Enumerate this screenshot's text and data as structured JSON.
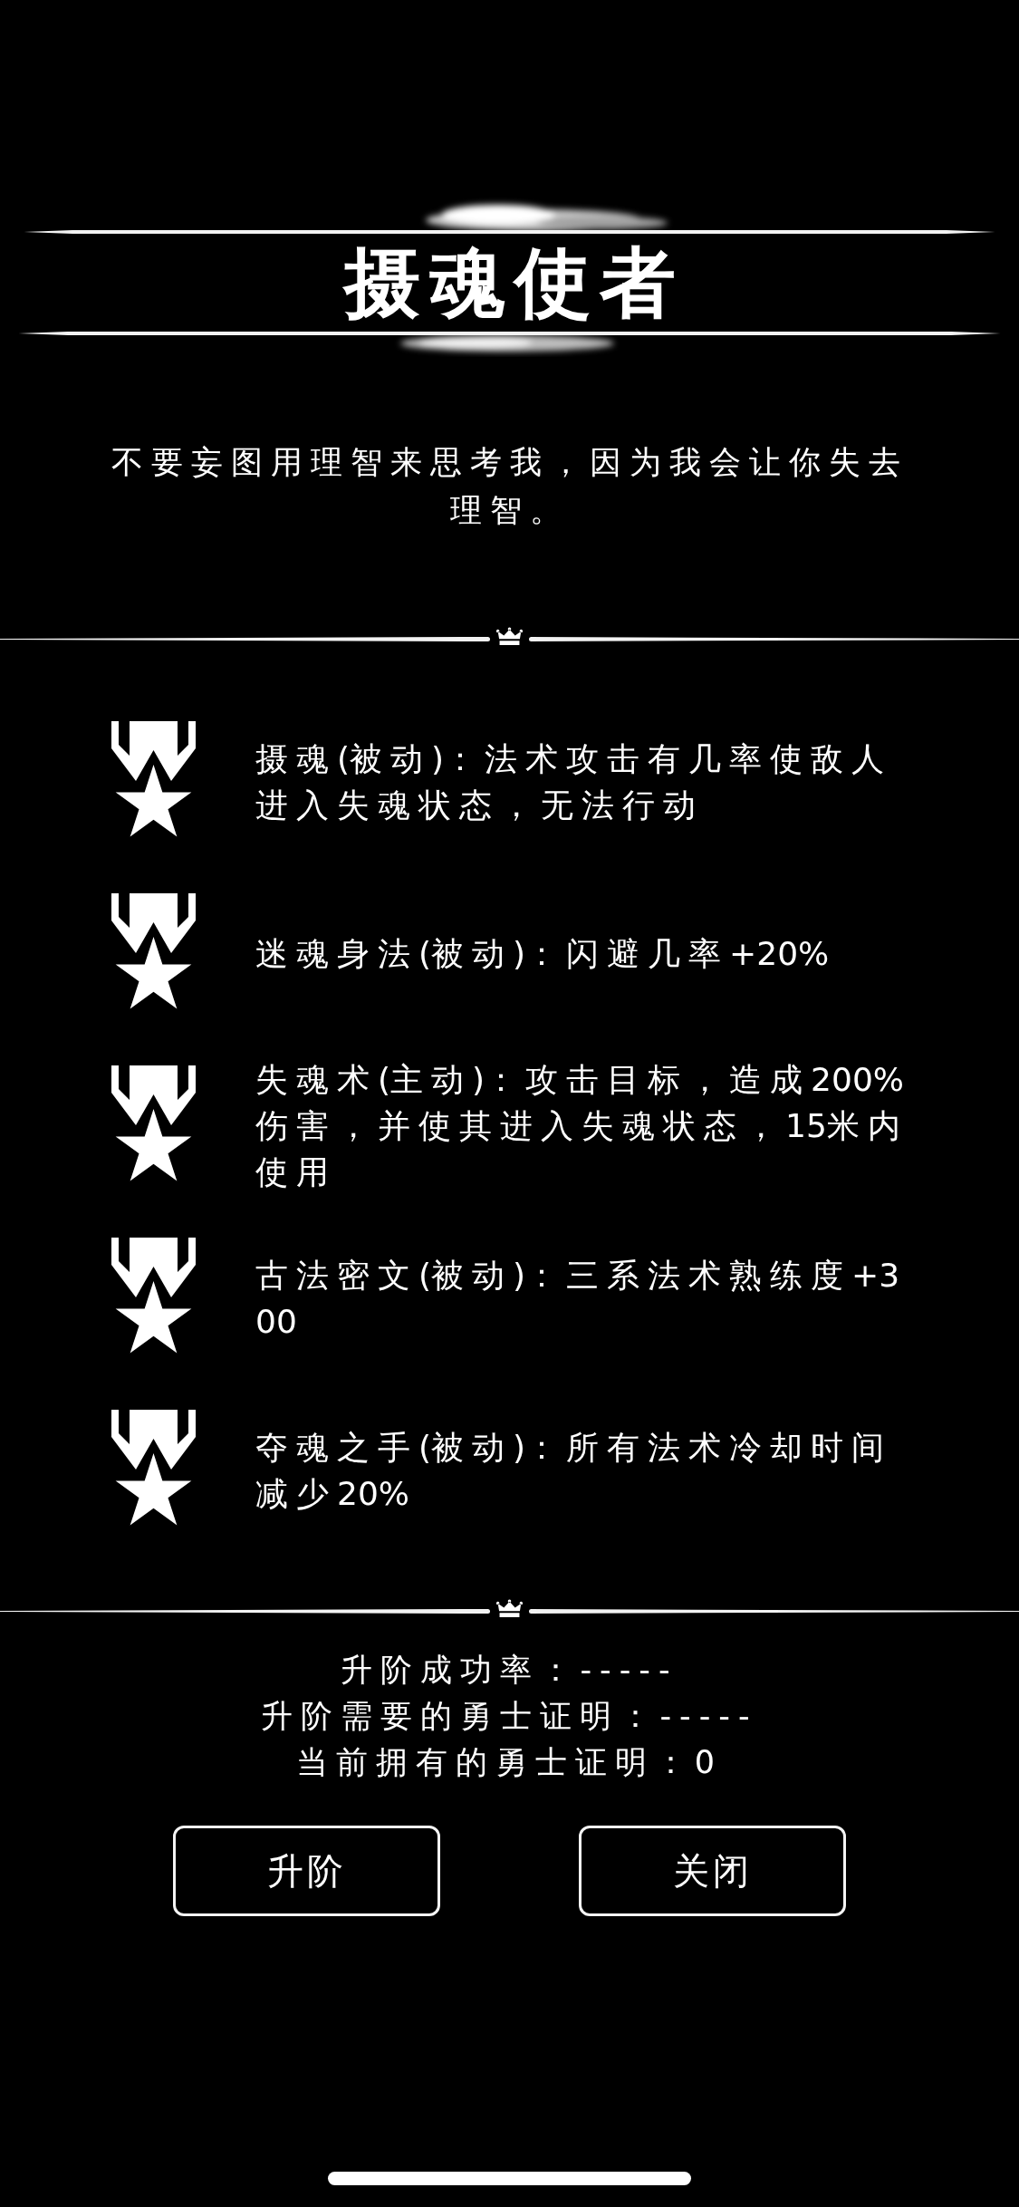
{
  "title": "摄魂使者",
  "quote": "不要妄图用理智来思考我，因为我会让你失去理智。",
  "skills": [
    {
      "description": "摄魂(被动)：法术攻击有几率使敌人进入失魂状态，无法行动"
    },
    {
      "description": "迷魂身法(被动)：闪避几率+20%"
    },
    {
      "description": "失魂术(主动)：攻击目标，造成200%伤害，并使其进入失魂状态，15米内使用"
    },
    {
      "description": "古法密文(被动)：三系法术熟练度+300"
    },
    {
      "description": "夺魂之手(被动)：所有法术冷却时间减少20%"
    }
  ],
  "upgrade_info": [
    "升阶成功率：-----",
    "升阶需要的勇士证明：-----",
    "当前拥有的勇士证明：0"
  ],
  "buttons": [
    "升阶",
    "关闭"
  ]
}
